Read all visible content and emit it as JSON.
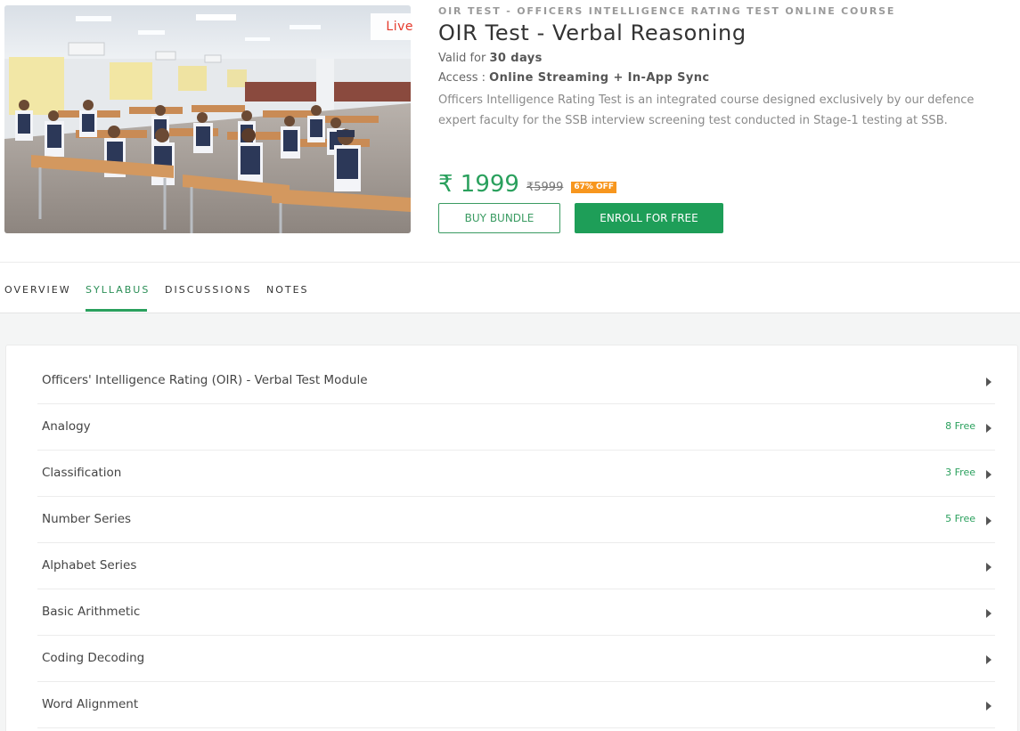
{
  "hero": {
    "live_label": "Live",
    "category": "OIR TEST - OFFICERS INTELLIGENCE RATING TEST ONLINE COURSE",
    "title": "OIR Test - Verbal Reasoning",
    "validity_prefix": "Valid for",
    "validity_value": "30 days",
    "access_prefix": "Access :",
    "access_value": "Online Streaming + In-App Sync",
    "description": "Officers Intelligence Rating Test is an integrated course designed exclusively by our defence expert faculty for the SSB interview screening test conducted in Stage-1 testing at SSB.",
    "price": "₹ 1999",
    "old_price": "₹5999",
    "discount": "67% OFF",
    "buy_bundle_label": "BUY BUNDLE",
    "enroll_label": "ENROLL FOR FREE",
    "image_alt": "classroom with students in uniform"
  },
  "tabs": [
    {
      "label": "OVERVIEW",
      "active": false
    },
    {
      "label": "SYLLABUS",
      "active": true
    },
    {
      "label": "DISCUSSIONS",
      "active": false
    },
    {
      "label": "NOTES",
      "active": false
    }
  ],
  "syllabus": [
    {
      "title": "Officers' Intelligence Rating (OIR) - Verbal Test Module",
      "free": ""
    },
    {
      "title": "Analogy",
      "free": "8 Free"
    },
    {
      "title": "Classification",
      "free": "3 Free"
    },
    {
      "title": "Number Series",
      "free": "5 Free"
    },
    {
      "title": "Alphabet Series",
      "free": ""
    },
    {
      "title": "Basic Arithmetic",
      "free": ""
    },
    {
      "title": "Coding Decoding",
      "free": ""
    },
    {
      "title": "Word Alignment",
      "free": ""
    }
  ],
  "colors": {
    "accent_green": "#2aa05d",
    "enroll_green": "#1e9e58",
    "live_red": "#e5392b",
    "discount_orange": "#f7961e"
  }
}
